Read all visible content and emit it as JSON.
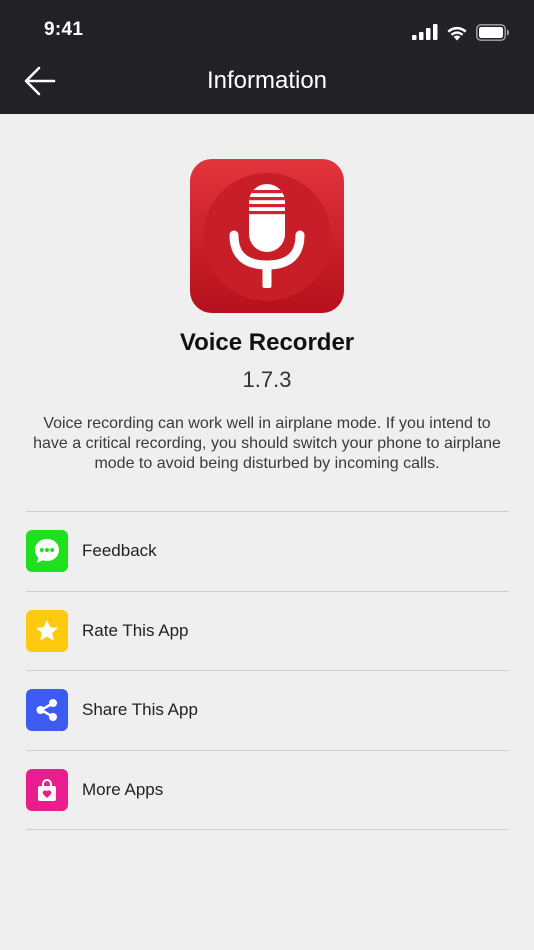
{
  "status_bar": {
    "time": "9:41"
  },
  "nav": {
    "title": "Information"
  },
  "app": {
    "name": "Voice Recorder",
    "version": "1.7.3",
    "description": "Voice recording can work well in airplane mode. If you intend to have a critical recording, you should switch your phone to airplane mode to avoid being disturbed by incoming calls."
  },
  "menu": {
    "items": [
      {
        "label": "Feedback",
        "icon": "chat-bubble-icon",
        "color": "#1ee01e"
      },
      {
        "label": "Rate This App",
        "icon": "star-icon",
        "color": "#ffc90e"
      },
      {
        "label": "Share This App",
        "icon": "share-icon",
        "color": "#3d5af1"
      },
      {
        "label": "More Apps",
        "icon": "shopping-bag-icon",
        "color": "#ea1d8f"
      }
    ]
  },
  "colors": {
    "topbar": "#222126",
    "background": "#efefef",
    "app_icon_red": "#d42330"
  }
}
